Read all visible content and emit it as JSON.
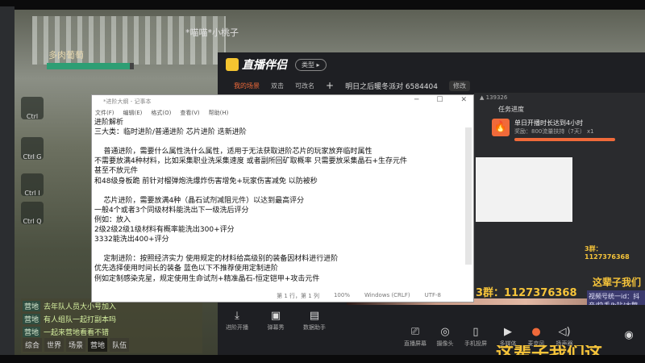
{
  "game": {
    "player_name": "多肉葡萄",
    "hp_fraction": 0.95,
    "top_name": "*喵喵*小桃子",
    "side_icons": [
      "Ctrl Tab",
      "Ctrl G",
      "Ctrl I",
      "Ctrl Q"
    ],
    "chat_lines": [
      {
        "tag": "营地",
        "text": "去年队人员大小号加入"
      },
      {
        "tag": "营地",
        "text": "有人组队一起打副本吗"
      },
      {
        "tag": "营地",
        "text": "一起来营地看看不错"
      }
    ],
    "chat_tabs": [
      "综合",
      "世界",
      "场景",
      "营地",
      "队伍"
    ],
    "chat_active": "营地"
  },
  "app": {
    "name": "直播伴侣",
    "type_pill": "类型 ▸",
    "tabs": [
      "我的场景",
      "双击",
      "可改名"
    ],
    "add": "+",
    "stream_title": "明日之后暖冬派对 6584404",
    "edit_label": "修改",
    "viewers": "139326",
    "task": {
      "header": "任务进度",
      "title": "单日开播时长达到4小时",
      "reward": "奖励：800流量扶持（7天） x1",
      "progress": 1.0
    },
    "qq_group": "3群：1127376368",
    "slogan": "这辈子我们",
    "side_text": "视频号统一id：抖音/快手/b站/大鹅",
    "bottom_left": [
      "进阶开播",
      "弹幕秀",
      "数据助手"
    ],
    "bottom_right": [
      "直播屏幕",
      "摄像头",
      "手机投屏",
      "多媒体",
      "麦克风",
      "扬声器"
    ],
    "big_text": "这辈子我们这"
  },
  "notepad": {
    "title": "*进阶大纲 - 记事本",
    "menu": [
      "文件(F)",
      "编辑(E)",
      "格式(O)",
      "查看(V)",
      "帮助(H)"
    ],
    "lines": [
      "进阶解析",
      "三大类：临时进阶/普通进阶 芯片进阶 迭新进阶",
      "",
      "    普通进阶，需要什么属性洗什么属性，适用于无法获取进阶芯片的玩家放弃临时属性",
      "不需要放满4种材料，比如采集职业洗采集速度 或者副所回矿取概率 只需要放采集晶石+生存元件",
      "甚至不放元件",
      "和48级身板跪 前针对榴弹炮洗爆炸伤害增免+玩家伤害减免 以防被秒",
      "",
      "    芯片进阶，需要放满4种（晶石试剂减阻元件）以达到最高评分",
      "一般4个或者3个同级材料能洗出下一级洗后评分",
      "例如：放入",
      "2级2级2级1级材料有概率能洗出300+评分",
      "3332能洗出400+评分",
      "",
      "    定制进阶：按照经济实力 使用规定的材料给高级别的装备因材料进行进阶",
      "优先选择使用时间长的装备 蓝色以下不推荐使用定制进阶",
      "例如定制感染克星，规定使用生命试剂+精准晶石-恒定铠甲+攻击元件"
    ],
    "status": [
      "第 1 行，第 1 列",
      "100%",
      "Windows (CRLF)",
      "UTF-8"
    ]
  }
}
